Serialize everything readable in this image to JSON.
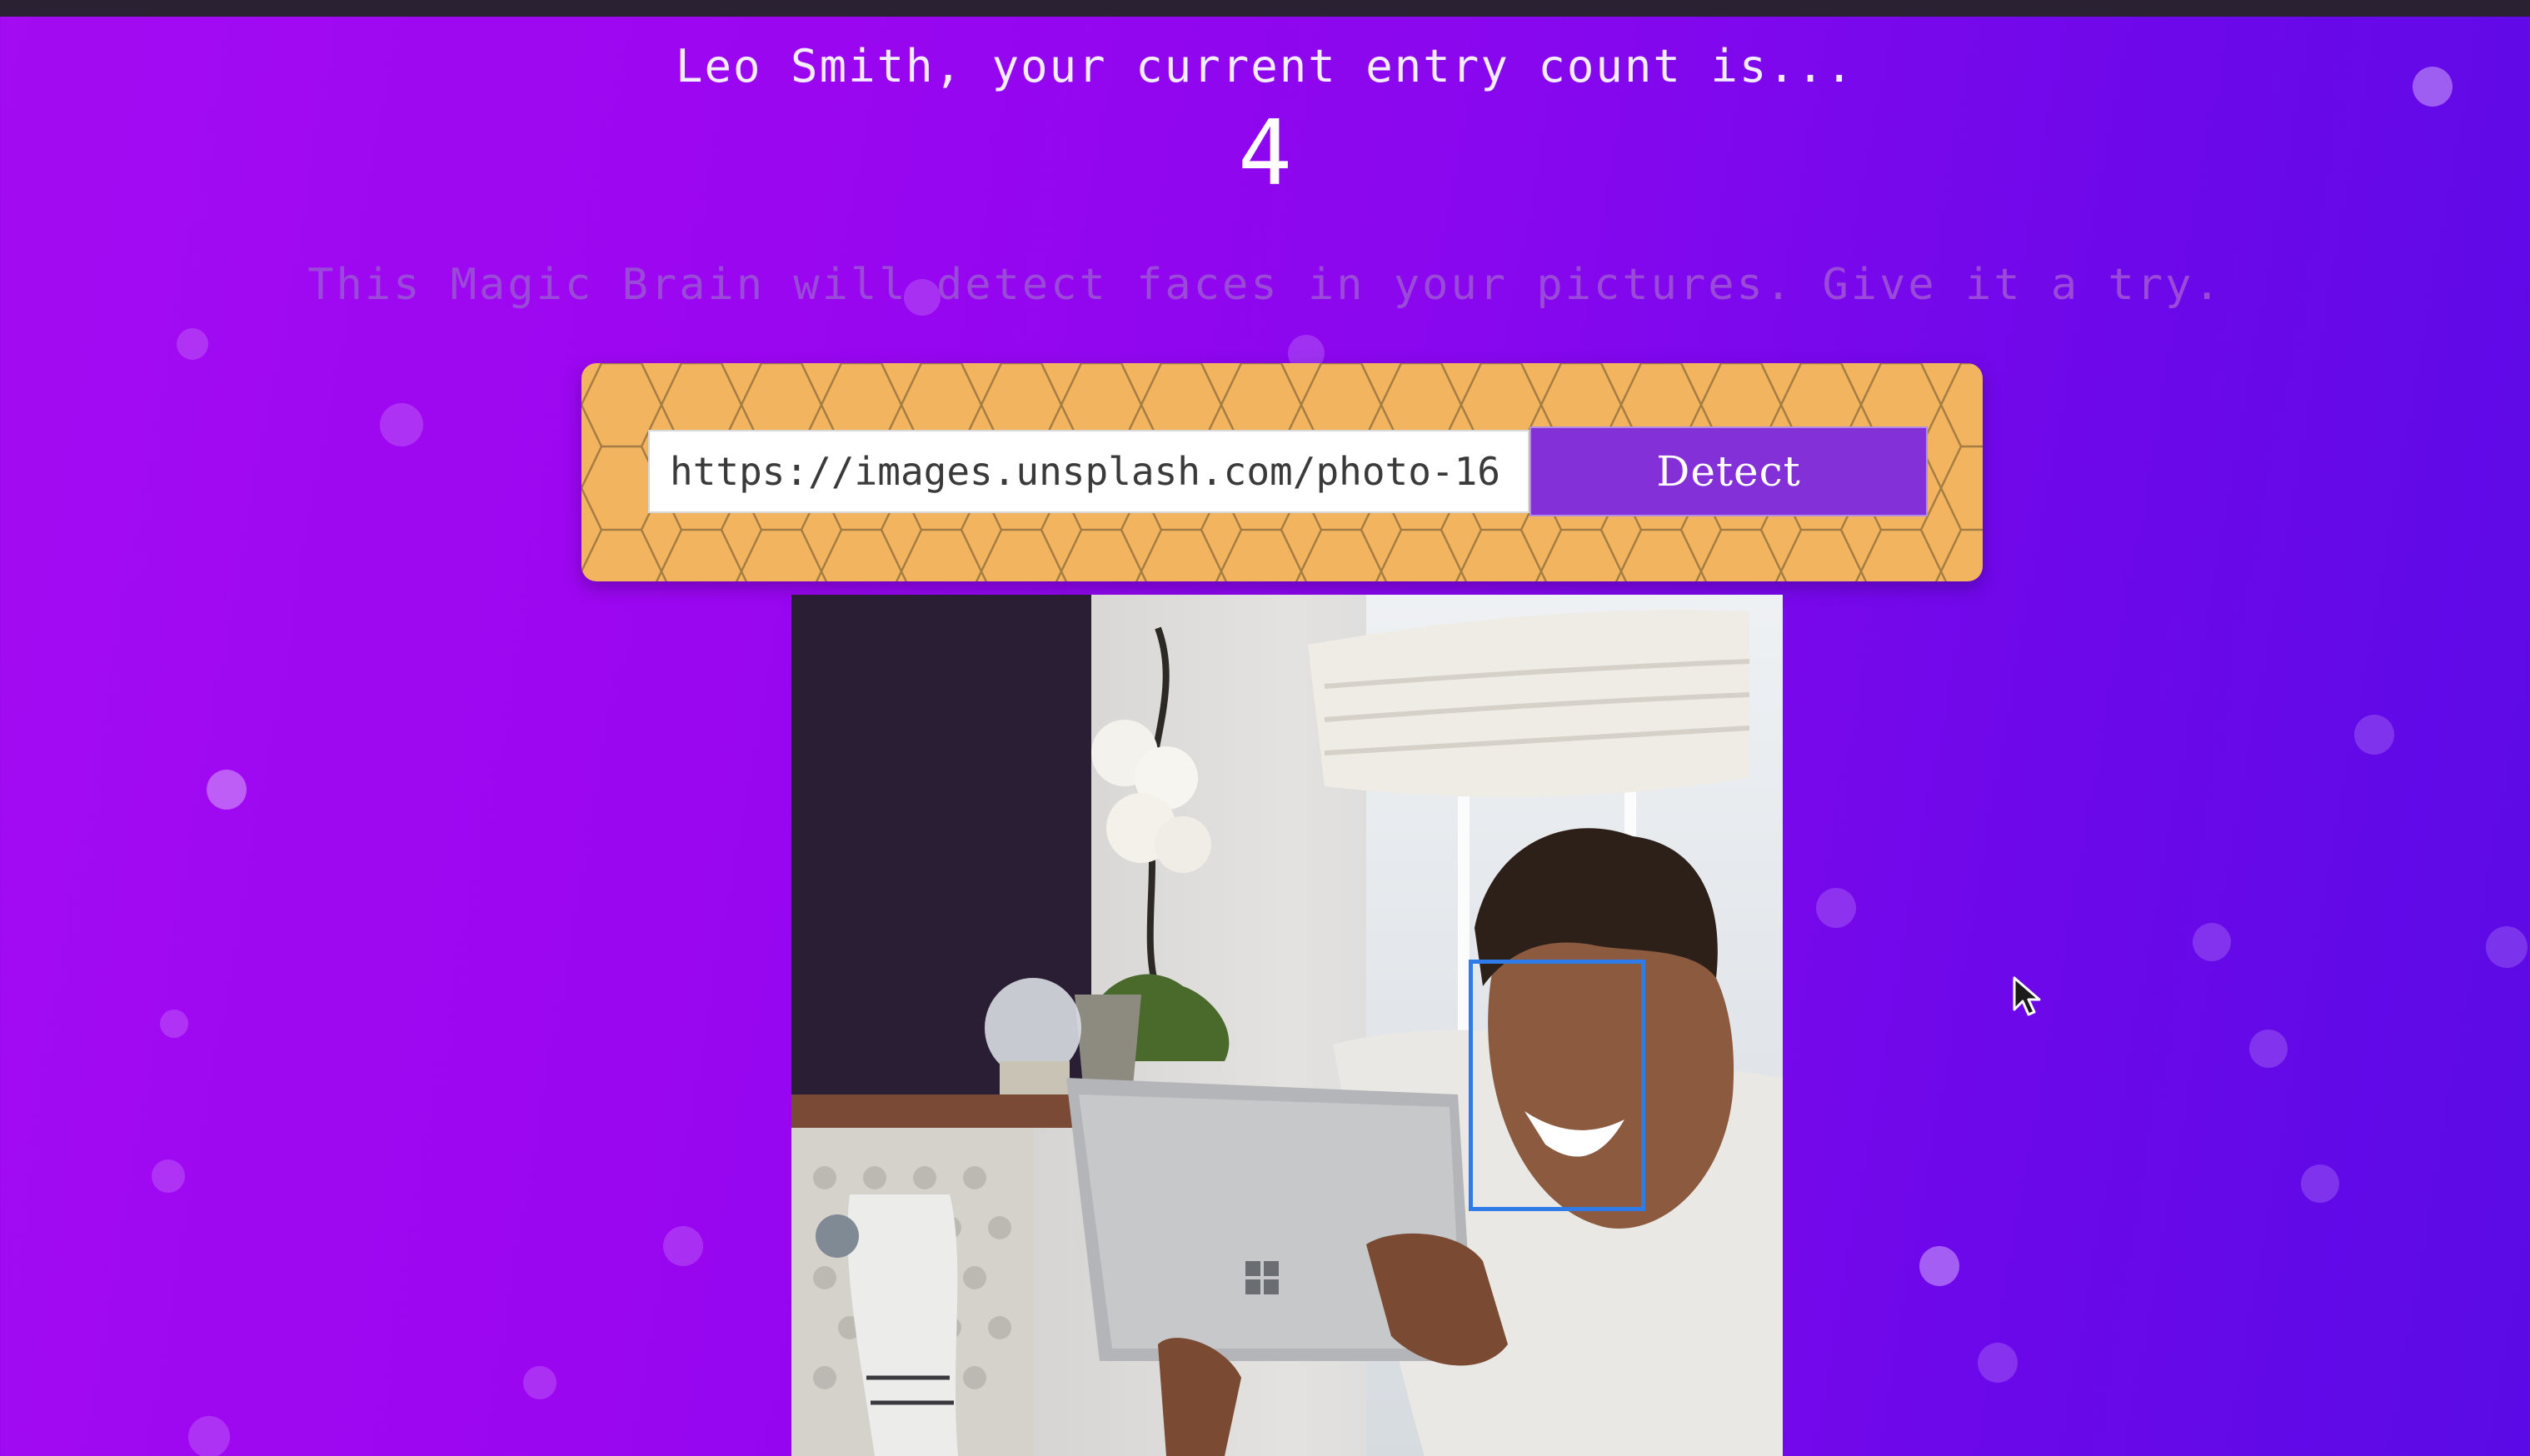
{
  "user": {
    "greeting": "Leo Smith, your current entry count is...",
    "entry_count": "4"
  },
  "tagline": "This Magic Brain will detect faces in your pictures. Give it a try.",
  "form": {
    "url_value": "https://images.unsplash.com/photo-16",
    "detect_label": "Detect"
  },
  "icons": {
    "cursor": "arrow-cursor-icon"
  },
  "colors": {
    "background_start": "#a30bf2",
    "background_end": "#5a0ae6",
    "panel": "#f2b45e",
    "button": "#8430d8",
    "face_box": "#2f7be8"
  }
}
